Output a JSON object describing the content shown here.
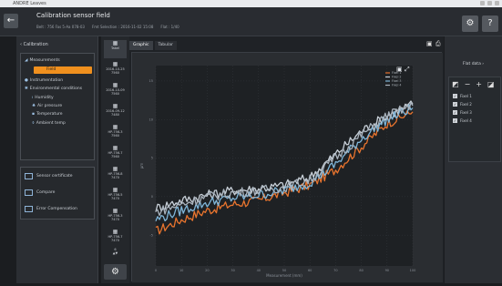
{
  "window": {
    "title": "ANDRE Leaves"
  },
  "header": {
    "back_icon": "arrow-left-icon",
    "title": "Calibration sensor field",
    "info": [
      "Belt : 756 Fas 5-Aa 078-03",
      "Fmt Selection : 2016-11-02 15:08",
      "Flat : 1/40"
    ],
    "buttons": [
      {
        "icon": "gear-icon",
        "glyph": "⚙"
      },
      {
        "icon": "help-icon",
        "glyph": "?"
      }
    ]
  },
  "sidebar": {
    "heading": "Calibration",
    "tree": [
      {
        "label": "Measurements",
        "icon": "chart-icon",
        "glyph": "◢"
      },
      {
        "label": "Field",
        "selected": true
      },
      {
        "label": "Instrumentation",
        "icon": "circle-icon",
        "glyph": "●"
      },
      {
        "label": "Environmental conditions",
        "icon": "sun-icon",
        "glyph": "✱"
      },
      {
        "label": "Humidity",
        "icon": "humidity-icon",
        "glyph": "ı"
      },
      {
        "label": "Air pressure",
        "icon": "pressure-icon",
        "glyph": "♣"
      },
      {
        "label": "Temperature",
        "icon": "thermometer-icon",
        "glyph": "▪"
      },
      {
        "label": "Ambient temp",
        "icon": "ambient-icon",
        "glyph": "⌽"
      }
    ],
    "actions": [
      {
        "label": "Sensor certificate"
      },
      {
        "label": "Compare"
      },
      {
        "label": "Error Compensation"
      }
    ]
  },
  "thumbs": [
    {
      "glyph": "▦",
      "lines": [
        "Tabel"
      ],
      "active": true
    },
    {
      "glyph": "▦",
      "lines": [
        "2016-10-25",
        "7560"
      ]
    },
    {
      "glyph": "▦",
      "lines": [
        "2016-10-09",
        "7560"
      ]
    },
    {
      "glyph": "▦",
      "lines": [
        "2016-09-12",
        "7480"
      ]
    },
    {
      "glyph": "▦",
      "lines": [
        "HP-756-3",
        "7560"
      ]
    },
    {
      "glyph": "▦",
      "lines": [
        "HP-756-7",
        "7560"
      ]
    },
    {
      "glyph": "▦",
      "lines": [
        "HP-756-8",
        "7470"
      ]
    },
    {
      "glyph": "▦",
      "lines": [
        "HP-756-5",
        "7470"
      ]
    },
    {
      "glyph": "▦",
      "lines": [
        "HP-756-3",
        "7470"
      ]
    },
    {
      "glyph": "▦",
      "lines": [
        "HP-756-7",
        "7470"
      ]
    },
    {
      "glyph": "▦",
      "lines": [
        "6",
        "▲▼"
      ]
    }
  ],
  "thumbs_gear": {
    "glyph": "⚙"
  },
  "main": {
    "tabs": [
      {
        "label": "Graphic",
        "active": true
      },
      {
        "label": "Tabular"
      }
    ],
    "chart_icons": [
      {
        "name": "export-icon",
        "glyph": "▣"
      },
      {
        "name": "print-icon",
        "glyph": "⎙"
      }
    ],
    "chart_tool_icons": [
      {
        "name": "zoom-icon",
        "glyph": "▣"
      },
      {
        "name": "fullscreen-icon",
        "glyph": "⤢"
      }
    ]
  },
  "right_panel": {
    "heading": "Flat data",
    "tools": [
      "◩",
      "−",
      "+",
      "◪"
    ],
    "series": [
      "Fixel 1",
      "Fixel 2",
      "Fixel 3",
      "Fixel 4"
    ]
  },
  "chart_data": {
    "type": "line",
    "x_tick_labels": [
      "0",
      "10",
      "20",
      "30",
      "40",
      "50",
      "60",
      "70",
      "80",
      "90",
      "100"
    ],
    "y_tick_labels": [
      "-5",
      "0",
      "5",
      "10",
      "15"
    ],
    "xlabel": "Measurement (mm)",
    "ylabel": "µm",
    "xlim": [
      0,
      100
    ],
    "ylim": [
      -9,
      17
    ],
    "grid": true,
    "legend": "top-right",
    "series": [
      {
        "name": "Fixel 1",
        "color": "#e8742e",
        "x": [
          0,
          10,
          20,
          30,
          40,
          50,
          60,
          70,
          80,
          90,
          100
        ],
        "values": [
          -4.5,
          -3.0,
          -1.8,
          -1.0,
          -0.5,
          0.5,
          1.5,
          3.5,
          6.5,
          9.5,
          11.0
        ]
      },
      {
        "name": "Fixel 2",
        "color": "#c8d0d8",
        "x": [
          0,
          10,
          20,
          30,
          40,
          50,
          60,
          70,
          80,
          90,
          100
        ],
        "values": [
          -1.5,
          -0.5,
          0.2,
          0.8,
          1.0,
          1.5,
          2.5,
          5.5,
          8.5,
          10.5,
          12.0
        ]
      },
      {
        "name": "Fixel 3",
        "color": "#7fb6d9",
        "x": [
          0,
          10,
          20,
          30,
          40,
          50,
          60,
          70,
          80,
          90,
          100
        ],
        "values": [
          -3.0,
          -1.8,
          -0.8,
          -0.2,
          0.2,
          0.8,
          1.8,
          4.2,
          7.5,
          10.0,
          11.5
        ]
      },
      {
        "name": "Fixel 4",
        "color": "#a9b3bd",
        "x": [
          0,
          10,
          20,
          30,
          40,
          50,
          60,
          70,
          80,
          90,
          100
        ],
        "values": [
          -2.0,
          -1.0,
          0.0,
          0.5,
          0.8,
          1.2,
          2.2,
          5.0,
          8.0,
          10.5,
          11.8
        ]
      }
    ]
  }
}
